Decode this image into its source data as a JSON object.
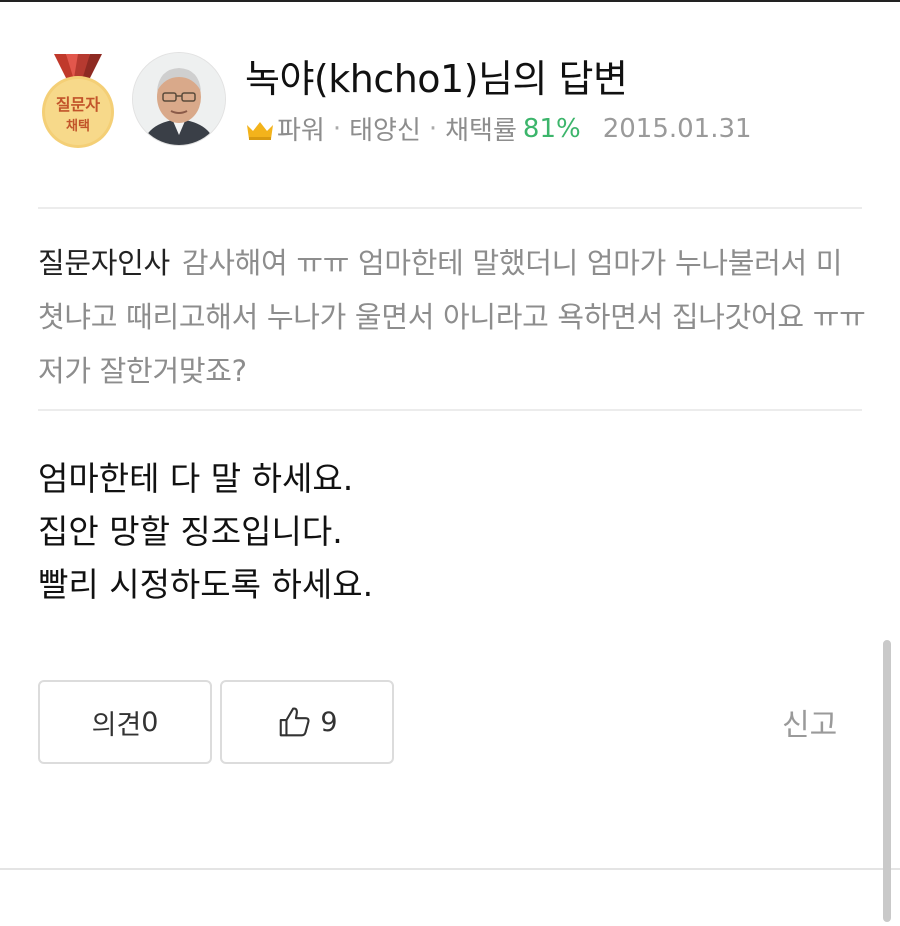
{
  "header": {
    "badge_line1": "질문자",
    "badge_line2": "채택",
    "title": "녹야(khcho1)님의 답변",
    "meta": {
      "grade": "파워",
      "separator": "·",
      "rank": "태양신",
      "adoption_label": "채택률",
      "adoption_rate": "81%",
      "date": "2015.01.31"
    }
  },
  "greeting": {
    "label": "질문자인사",
    "text": "감사해여 ㅠㅠ 엄마한테 말했더니 엄마가 누나불러서 미쳣냐고 때리고해서 누나가 울면서 아니라고 욕하면서 집나갓어요 ㅠㅠ저가 잘한거맞죠?"
  },
  "answer": {
    "lines": [
      "엄마한테 다 말 하세요.",
      "집안 망할 징조입니다.",
      "빨리 시정하도록 하세요."
    ]
  },
  "actions": {
    "comment_label": "의견",
    "comment_count": "0",
    "like_count": "9",
    "report_label": "신고"
  },
  "colors": {
    "accent_green": "#3cb56b",
    "medal_gold": "#f2c96a",
    "crown_gold": "#f3b31b"
  }
}
